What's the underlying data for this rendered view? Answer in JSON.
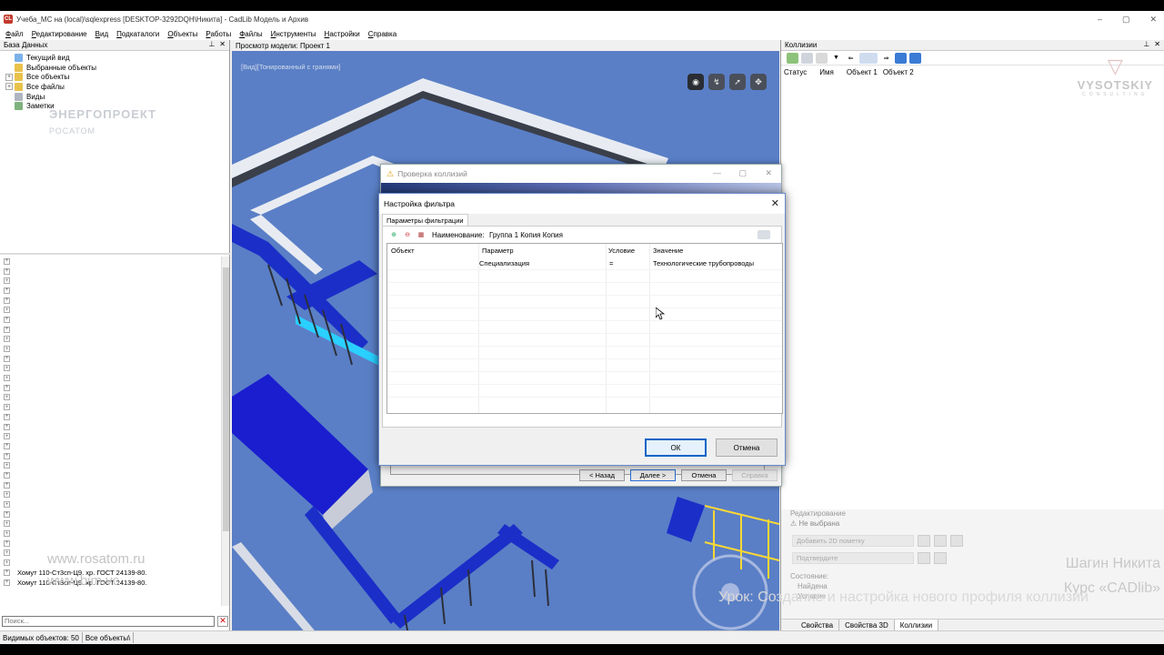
{
  "window": {
    "title": "Учеба_MC на (local)\\sqlexpress [DESKTOP-3292DQH\\Никита] - CadLib Модель и Архив",
    "controls": [
      "–",
      "▢",
      "✕"
    ]
  },
  "menu": [
    "Файл",
    "Редактирование",
    "Вид",
    "Подкаталоги",
    "Объекты",
    "Работы",
    "Файлы",
    "Инструменты",
    "Настройки",
    "Справка"
  ],
  "left_panel": {
    "header": "База Данных",
    "tree": [
      {
        "label": "Текущий вид",
        "expand": false,
        "color": "#7bb2e8"
      },
      {
        "label": "Выбранные объекты",
        "expand": false,
        "color": "#e8c24b"
      },
      {
        "label": "Все объекты",
        "expand": true,
        "color": "#e8c24b"
      },
      {
        "label": "Все файлы",
        "expand": true,
        "color": "#e8c24b"
      },
      {
        "label": "Виды",
        "expand": false,
        "color": "#b0b6c0"
      },
      {
        "label": "Заметки",
        "expand": false,
        "color": "#7fb27f"
      }
    ],
    "watermark_logo": "ЭНЕРГОПРОЕКТ",
    "watermark_logo_sub": "РОСАТОМ",
    "watermark_url1": "www.rosatom.ru",
    "watermark_url2": "www.bim.vc",
    "list_items": [
      "Хомут 110-Ст3сп-Ц9. хр. ГОСТ 24139-80.",
      "Хомут 110-Ст3сп-Ц9. хр. ГОСТ 24139-80."
    ],
    "search_placeholder": "Поиск...",
    "nav_buttons": [
      "«",
      "»",
      "⊞"
    ]
  },
  "status_bar": {
    "visible_objects": "Видимых объектов: 50",
    "filter": "Все объекты\\"
  },
  "viewport": {
    "header": "Просмотр модели: Проект 1",
    "view_label": "[Вид][Тонированный с гранями]",
    "nav_icons": [
      "eye-icon",
      "walk-icon",
      "fly-icon",
      "pan-icon"
    ]
  },
  "right_panel": {
    "header": "Коллизии",
    "columns": [
      "Статус",
      "Имя",
      "Объект 1",
      "Объект 2"
    ],
    "watermark_brand": "VYSOTSKIY",
    "watermark_sub": "CONSULTING",
    "props": {
      "section": "Редактирование",
      "not_selected": "Не выбрана",
      "add_2d": "Добавить 2D пометку",
      "confirm": "Подтвердите",
      "state_label": "Состояние:",
      "found": "Найдена",
      "condition": "Условие"
    },
    "tabs": [
      "Свойства",
      "Свойства 3D",
      "Коллизии"
    ],
    "active_tab": "Коллизии"
  },
  "credits": {
    "author": "Шагин Никита",
    "course": "Курс «CADlib»",
    "lesson": "Урок: Создание и настройка нового профиля коллизий"
  },
  "dialog_back": {
    "title": "Проверка коллизий",
    "buttons": {
      "back": "< Назад",
      "next": "Далее >",
      "cancel": "Отмена",
      "help": "Справка"
    }
  },
  "dialog_filter": {
    "title": "Настройка фильтра",
    "tab": "Параметры фильтрации",
    "name_label": "Наименование:",
    "name_value": "Группа 1 Копия Копия",
    "columns": [
      "Объект",
      "Параметр",
      "Условие",
      "Значение"
    ],
    "rows": [
      {
        "object": "",
        "parameter": "Специализация",
        "condition": "=",
        "value": "Технологические трубопроводы"
      }
    ],
    "ok": "ОК",
    "cancel": "Отмена"
  }
}
